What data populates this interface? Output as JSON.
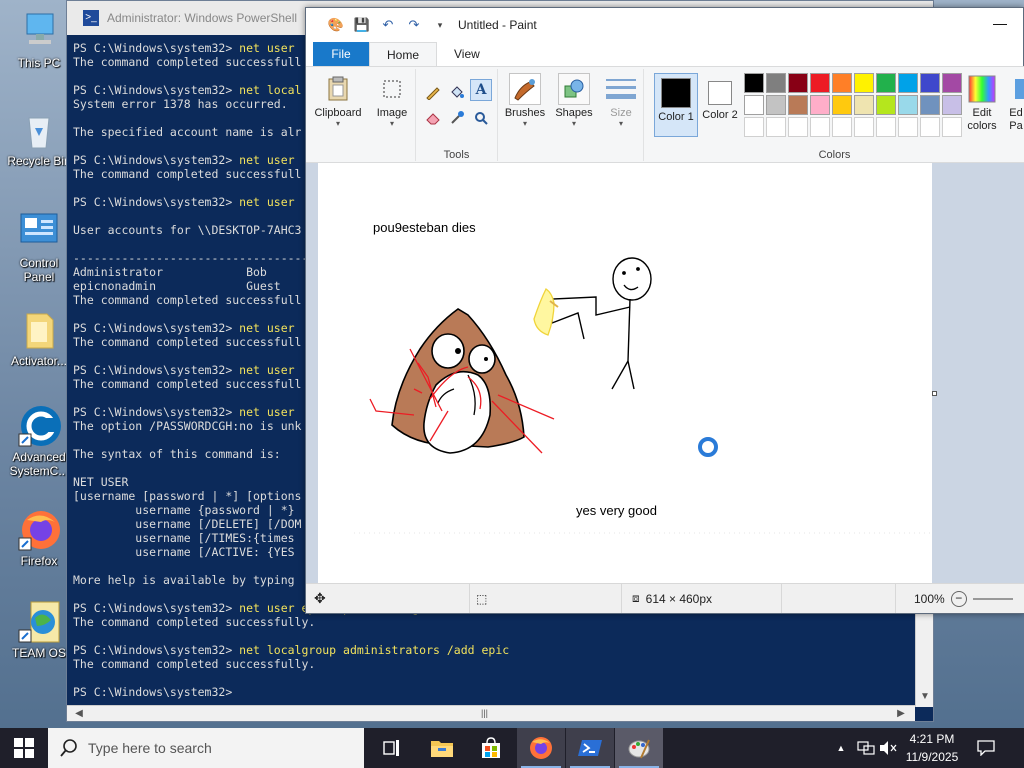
{
  "desktop": {
    "icons": [
      {
        "label": "This PC"
      },
      {
        "label": "Recycle Bin"
      },
      {
        "label": "Control Panel"
      },
      {
        "label": "Activator..."
      },
      {
        "label": "Advanced SystemC..."
      },
      {
        "label": "Firefox"
      },
      {
        "label": "TEAM OS"
      }
    ]
  },
  "powershell": {
    "title": "Administrator: Windows PowerShell",
    "lines": [
      {
        "prompt": "PS C:\\Windows\\system32> ",
        "cmd": "net user"
      },
      {
        "text": "The command completed successfull"
      },
      {
        "text": ""
      },
      {
        "prompt": "PS C:\\Windows\\system32> ",
        "cmd": "net local"
      },
      {
        "text": "System error 1378 has occurred."
      },
      {
        "text": ""
      },
      {
        "text": "The specified account name is alr"
      },
      {
        "text": ""
      },
      {
        "prompt": "PS C:\\Windows\\system32> ",
        "cmd": "net user"
      },
      {
        "text": "The command completed successfull"
      },
      {
        "text": ""
      },
      {
        "prompt": "PS C:\\Windows\\system32> ",
        "cmd": "net user"
      },
      {
        "text": ""
      },
      {
        "text": "User accounts for \\\\DESKTOP-7AHC3"
      },
      {
        "text": ""
      },
      {
        "text": "-------------------------------------"
      },
      {
        "text": "Administrator            Bob"
      },
      {
        "text": "epicnonadmin             Guest"
      },
      {
        "text": "The command completed successfull"
      },
      {
        "text": ""
      },
      {
        "prompt": "PS C:\\Windows\\system32> ",
        "cmd": "net user"
      },
      {
        "text": "The command completed successfull"
      },
      {
        "text": ""
      },
      {
        "prompt": "PS C:\\Windows\\system32> ",
        "cmd": "net user"
      },
      {
        "text": "The command completed successfull"
      },
      {
        "text": ""
      },
      {
        "prompt": "PS C:\\Windows\\system32> ",
        "cmd": "net user"
      },
      {
        "text": "The option /PASSWORDCGH:no is unk"
      },
      {
        "text": ""
      },
      {
        "text": "The syntax of this command is:"
      },
      {
        "text": ""
      },
      {
        "text": "NET USER"
      },
      {
        "text": "[username [password | *] [options"
      },
      {
        "text": "         username {password | *}"
      },
      {
        "text": "         username [/DELETE] [/DOM"
      },
      {
        "text": "         username [/TIMES:{times"
      },
      {
        "text": "         username [/ACTIVE: {YES"
      },
      {
        "text": ""
      },
      {
        "text": "More help is available by typing"
      },
      {
        "text": ""
      },
      {
        "prompt": "PS C:\\Windows\\system32> ",
        "cmd": "net user epic /passwordchg:no"
      },
      {
        "text": "The command completed successfully."
      },
      {
        "text": ""
      },
      {
        "prompt": "PS C:\\Windows\\system32> ",
        "cmd": "net localgroup administrators /add epic"
      },
      {
        "text": "The command completed successfully."
      },
      {
        "text": ""
      },
      {
        "prompt": "PS C:\\Windows\\system32> ",
        "cmd": ""
      }
    ]
  },
  "paint": {
    "title": "Untitled - Paint",
    "tabs": {
      "file": "File",
      "home": "Home",
      "view": "View"
    },
    "ribbon": {
      "clipboard": "Clipboard",
      "image": "Image",
      "tools_group": "Tools",
      "brushes": "Brushes",
      "shapes": "Shapes",
      "size": "Size",
      "color1": "Color 1",
      "color2": "Color 2",
      "colors_group": "Colors",
      "edit_colors": "Edit colors",
      "edit_paint3d": "Ed Pa"
    },
    "palette_row1": [
      "#000000",
      "#7f7f7f",
      "#880015",
      "#ed1c24",
      "#ff7f27",
      "#fff200",
      "#22b14c",
      "#00a2e8",
      "#3f48cc",
      "#a349a4"
    ],
    "palette_row2": [
      "#ffffff",
      "#c3c3c3",
      "#b97a57",
      "#ffaec9",
      "#ffc90e",
      "#efe4b0",
      "#b5e61d",
      "#99d9ea",
      "#7092be",
      "#c8bfe7"
    ],
    "canvas_text": {
      "caption_top": "pou9esteban dies",
      "caption_bottom": "yes very good"
    },
    "status": {
      "dimensions": "614 × 460px",
      "zoom": "100%"
    }
  },
  "taskbar": {
    "search_placeholder": "Type here to search",
    "time": "4:21 PM",
    "date": "11/9/2025"
  }
}
